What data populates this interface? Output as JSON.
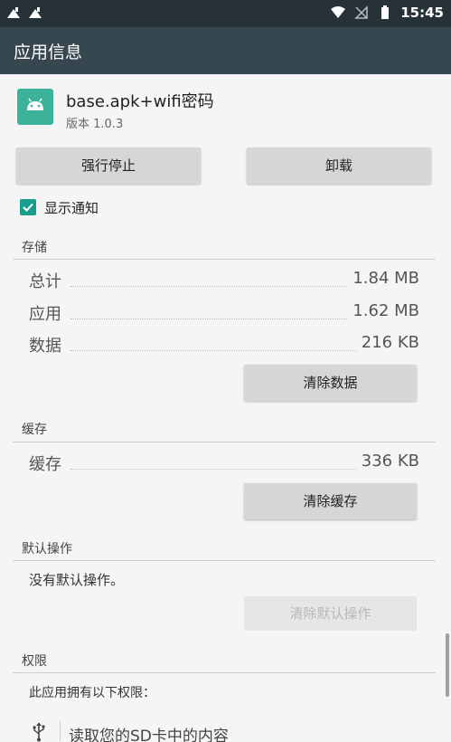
{
  "status_bar": {
    "time": "15:45",
    "left_icons": [
      "notification-app-icon",
      "notification-app-icon"
    ],
    "right_icons": [
      "wifi-icon",
      "no-sim-icon",
      "battery-icon"
    ]
  },
  "app_bar": {
    "title": "应用信息"
  },
  "app": {
    "icon": "android-icon",
    "name": "base.apk+wifi密码",
    "version": "版本 1.0.3"
  },
  "actions": {
    "force_stop": "强行停止",
    "uninstall": "卸载"
  },
  "notifications": {
    "label": "显示通知",
    "checked": true
  },
  "storage": {
    "header": "存储",
    "rows": [
      {
        "label": "总计",
        "value": "1.84 MB"
      },
      {
        "label": "应用",
        "value": "1.62 MB"
      },
      {
        "label": "数据",
        "value": "216 KB"
      }
    ],
    "clear_button": "清除数据"
  },
  "cache": {
    "header": "缓存",
    "row": {
      "label": "缓存",
      "value": "336 KB"
    },
    "clear_button": "清除缓存"
  },
  "defaults": {
    "header": "默认操作",
    "text": "没有默认操作。",
    "clear_button": "清除默认操作"
  },
  "permissions": {
    "header": "权限",
    "intro": "此应用拥有以下权限：",
    "items": [
      {
        "icon": "usb-icon",
        "label": "读取您的SD卡中的内容"
      }
    ]
  },
  "colors": {
    "status_bar": "#263238",
    "app_bar": "#37474f",
    "accent": "#1a9e8c",
    "app_icon_bg": "#3bb39a"
  }
}
